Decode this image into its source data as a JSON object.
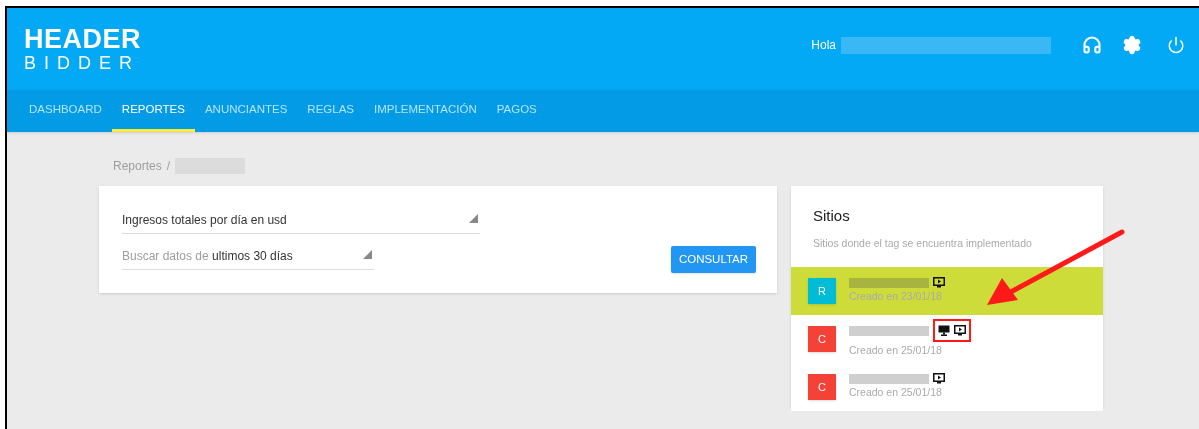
{
  "logo": {
    "line1": "HEADER",
    "line2": "BIDDER"
  },
  "greeting": "Hola",
  "nav": [
    {
      "label": "DASHBOARD",
      "selected": false
    },
    {
      "label": "REPORTES",
      "selected": true
    },
    {
      "label": "ANUNCIANTES",
      "selected": false
    },
    {
      "label": "REGLAS",
      "selected": false
    },
    {
      "label": "IMPLEMENTACIÓN",
      "selected": false
    },
    {
      "label": "PAGOS",
      "selected": false
    }
  ],
  "breadcrumb": {
    "root": "Reportes",
    "separator": "/"
  },
  "report": {
    "metric": "Ingresos totales por día en usd",
    "range_label": "Buscar datos de",
    "range_value": "ultimos 30 días",
    "button": "CONSULTAR"
  },
  "sites_panel": {
    "title": "Sitios",
    "subtitle": "Sitios donde el tag se encuentra implementado",
    "sites": [
      {
        "letter": "R",
        "color": "#00bcd4",
        "created": "Creado en 23/01/18",
        "selected": true,
        "highlighted": false,
        "devices": [
          {
            "kind": "video"
          }
        ]
      },
      {
        "letter": "C",
        "color": "#f44336",
        "created": "Creado en 25/01/18",
        "selected": false,
        "highlighted": true,
        "devices": [
          {
            "kind": "desktop"
          },
          {
            "kind": "video"
          }
        ]
      },
      {
        "letter": "C",
        "color": "#f44336",
        "created": "Creado en 25/01/18",
        "selected": false,
        "highlighted": false,
        "devices": [
          {
            "kind": "video"
          }
        ]
      }
    ]
  }
}
